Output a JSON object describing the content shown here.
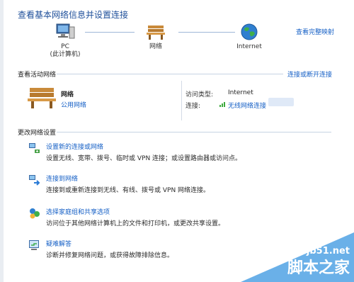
{
  "header": {
    "title": "查看基本网络信息并设置连接",
    "full_map_link": "查看完整映射"
  },
  "network_map": {
    "nodes": [
      {
        "icon": "pc-icon",
        "label": "PC",
        "sublabel": "(此计算机)"
      },
      {
        "icon": "bench-network-icon",
        "label": "网络"
      },
      {
        "icon": "globe-icon",
        "label": "Internet"
      }
    ]
  },
  "active_networks": {
    "heading": "查看活动网络",
    "connect_link": "连接或断开连接",
    "network": {
      "icon": "bench-network-icon",
      "name": "网络",
      "type": "公用网络"
    },
    "access_type_label": "访问类型:",
    "access_type_value": "Internet",
    "connection_label": "连接:",
    "connection_value": "无线网络连接"
  },
  "change_settings": {
    "heading": "更改网络设置",
    "tasks": [
      {
        "icon": "new-connection-icon",
        "title": "设置新的连接或网络",
        "desc": "设置无线、宽带、拨号、临时或 VPN 连接；或设置路由器或访问点。"
      },
      {
        "icon": "connect-network-icon",
        "title": "连接到网络",
        "desc": "连接到或重新连接到无线、有线、拨号或 VPN 网络连接。"
      },
      {
        "icon": "homegroup-icon",
        "title": "选择家庭组和共享选项",
        "desc": "访问位于其他网络计算机上的文件和打印机，或更改共享设置。"
      },
      {
        "icon": "troubleshoot-icon",
        "title": "疑难解答",
        "desc": "诊断并修复网络问题，或获得故障排除信息。"
      }
    ]
  },
  "watermark": {
    "site": "jb51.net",
    "name": "脚本之家"
  }
}
